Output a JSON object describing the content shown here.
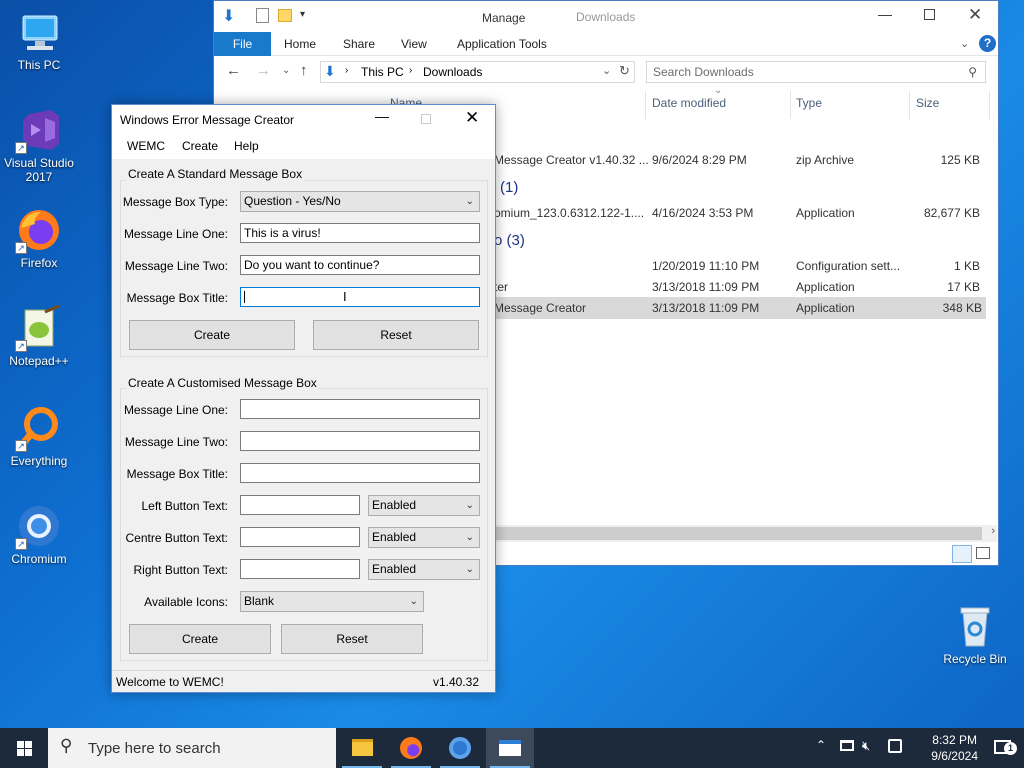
{
  "desktop": {
    "icons": [
      {
        "label": "This PC"
      },
      {
        "label": "Visual Studio 2017"
      },
      {
        "label": "Firefox"
      },
      {
        "label": "Notepad++"
      },
      {
        "label": "Everything"
      },
      {
        "label": "Chromium"
      },
      {
        "label": "Recycle Bin"
      }
    ]
  },
  "explorer": {
    "title": "Downloads",
    "manage_label": "Manage",
    "ribbon_tabs": {
      "file": "File",
      "home": "Home",
      "share": "Share",
      "view": "View",
      "app_tools": "Application Tools"
    },
    "breadcrumb": {
      "root": "This PC",
      "current": "Downloads"
    },
    "search_placeholder": "Search Downloads",
    "columns": {
      "name": "Name",
      "date": "Date modified",
      "type": "Type",
      "size": "Size"
    },
    "groups": [
      "(1)",
      "o (3)"
    ],
    "rows": [
      {
        "name": "Message Creator v1.40.32 ...",
        "date": "9/6/2024 8:29 PM",
        "type": "zip Archive",
        "size": "125 KB"
      },
      {
        "name": "omium_123.0.6312.122-1....",
        "date": "4/16/2024 3:53 PM",
        "type": "Application",
        "size": "82,677 KB"
      },
      {
        "name": "",
        "date": "1/20/2019 11:10 PM",
        "type": "Configuration sett...",
        "size": "1 KB"
      },
      {
        "name": "ter",
        "date": "3/13/2018 11:09 PM",
        "type": "Application",
        "size": "17 KB"
      },
      {
        "name": "Message Creator",
        "date": "3/13/2018 11:09 PM",
        "type": "Application",
        "size": "348 KB"
      }
    ]
  },
  "wemc": {
    "title": "Windows Error Message Creator",
    "menu": {
      "wemc": "WEMC",
      "create": "Create",
      "help": "Help"
    },
    "standard": {
      "group_title": "Create A Standard Message Box",
      "type_label": "Message Box Type:",
      "type_value": "Question - Yes/No",
      "line1_label": "Message Line One:",
      "line1_value": "This is  a virus!",
      "line2_label": "Message Line Two:",
      "line2_value": "Do you want to continue?",
      "title_label": "Message Box Title:",
      "title_value": "",
      "create_label": "Create",
      "reset_label": "Reset"
    },
    "custom": {
      "group_title": "Create A Customised Message Box",
      "line1_label": "Message Line One:",
      "line2_label": "Message Line Two:",
      "title_label": "Message Box Title:",
      "left_label": "Left Button Text:",
      "centre_label": "Centre Button Text:",
      "right_label": "Right Button Text:",
      "left_state": "Enabled",
      "centre_state": "Enabled",
      "right_state": "Enabled",
      "icons_label": "Available Icons:",
      "icons_value": "Blank",
      "create_label": "Create",
      "reset_label": "Reset"
    },
    "status": {
      "left": "Welcome to WEMC!",
      "right": "v1.40.32"
    }
  },
  "taskbar": {
    "search_placeholder": "Type here to search",
    "time": "8:32 PM",
    "date": "9/6/2024",
    "notification_count": "1"
  },
  "colors": {
    "accent": "#0078d7",
    "file_tab": "#1979ca",
    "manage_tab": "#e8d8f4",
    "taskbar": "#1c2a3b"
  }
}
